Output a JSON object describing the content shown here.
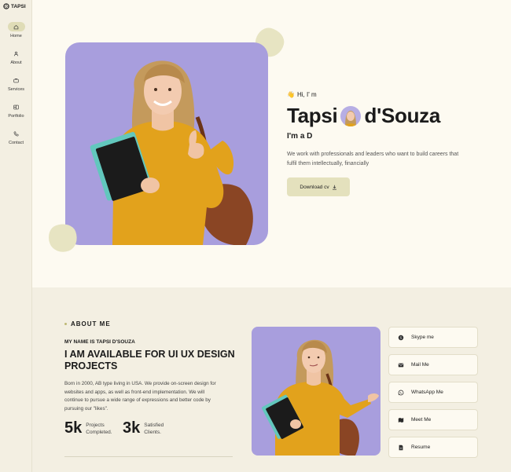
{
  "brand": {
    "name": "TAPSI",
    "logo_icon": "aperture-icon"
  },
  "nav": [
    {
      "label": "Home",
      "icon": "home-icon",
      "active": true
    },
    {
      "label": "About",
      "icon": "user-icon",
      "active": false
    },
    {
      "label": "Services",
      "icon": "briefcase-icon",
      "active": false
    },
    {
      "label": "Portfolio",
      "icon": "portfolio-icon",
      "active": false
    },
    {
      "label": "Contact",
      "icon": "phone-icon",
      "active": false
    }
  ],
  "hero": {
    "greeting": "Hi, I' m",
    "greeting_icon": "waving-hand-icon",
    "name_first": "Tapsi",
    "name_last": "d'Souza",
    "role": "I'm a D",
    "description": "We work with professionals and leaders who want to build careers that fulfil them intellectually, financially",
    "cv_button": "Download cv"
  },
  "about": {
    "section_label": "ABOUT ME",
    "subtitle": "MY NAME IS TAPSI D'SOUZA",
    "title": "I AM AVAILABLE FOR UI UX DESIGN PROJECTS",
    "description": "Born in 2000, AB type living in USA. We provide on-screen design for websites and apps, as well as front-end implementation. We will continue to pursue a wide range of expressions and better code by pursuing our \"likes\".",
    "stats": [
      {
        "value": "5k",
        "label_line1": "Projects",
        "label_line2": "Completed."
      },
      {
        "value": "3k",
        "label_line1": "Satisfied",
        "label_line2": "Clients."
      }
    ],
    "contacts": [
      {
        "label": "Skype me",
        "icon": "skype-icon"
      },
      {
        "label": "Mail Me",
        "icon": "mail-icon"
      },
      {
        "label": "WhatsApp Me",
        "icon": "whatsapp-icon"
      },
      {
        "label": "Meet Me",
        "icon": "map-icon"
      },
      {
        "label": "Resume",
        "icon": "resume-icon"
      }
    ]
  },
  "colors": {
    "background": "#fdfaf1",
    "sidebar": "#f3efe2",
    "accent": "#e4e1bd",
    "photo_bg": "#a89edd",
    "sweater": "#e2a21c"
  }
}
